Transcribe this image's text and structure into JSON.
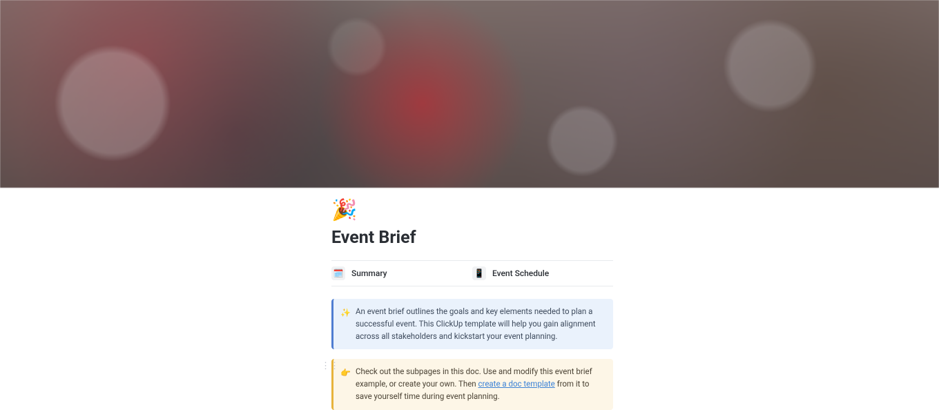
{
  "page": {
    "emoji": "🎉",
    "title": "Event Brief"
  },
  "subpages": [
    {
      "icon": "🗓️",
      "label": "Summary"
    },
    {
      "icon": "📱",
      "label": "Event Schedule"
    }
  ],
  "callouts": {
    "info": {
      "emoji": "✨",
      "text": "An event brief outlines the goals and key elements needed to plan a successful event. This ClickUp template will help you gain alignment across all stakeholders and kickstart your event planning."
    },
    "tip": {
      "emoji": "👉",
      "text_before": "Check out the subpages in this doc. Use and modify this event brief example, or create your own. Then ",
      "link_text": "create a doc template",
      "text_after": " from it to save yourself time during event planning."
    }
  }
}
